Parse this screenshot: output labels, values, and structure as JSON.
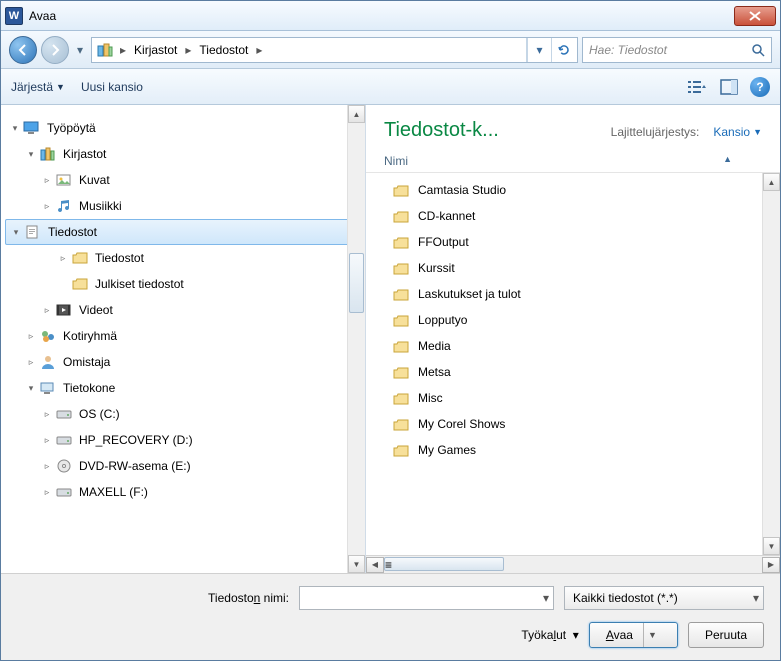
{
  "title": "Avaa",
  "breadcrumb": {
    "root_icon": "libraries",
    "items": [
      "Kirjastot",
      "Tiedostot"
    ]
  },
  "search": {
    "placeholder": "Hae: Tiedostot"
  },
  "toolbar": {
    "organize": "Järjestä",
    "new_folder": "Uusi kansio"
  },
  "list_header": {
    "title": "Tiedostot-k...",
    "sort_label": "Lajittelujärjestys:",
    "sort_value": "Kansio"
  },
  "columns": {
    "name": "Nimi"
  },
  "tree": [
    {
      "label": "Työpöytä",
      "level": 0,
      "icon": "desktop",
      "tw": "▾"
    },
    {
      "label": "Kirjastot",
      "level": 1,
      "icon": "libraries",
      "tw": "▾"
    },
    {
      "label": "Kuvat",
      "level": 2,
      "icon": "lib-pic",
      "tw": "▹"
    },
    {
      "label": "Musiikki",
      "level": 2,
      "icon": "lib-music",
      "tw": "▹"
    },
    {
      "label": "Tiedostot",
      "level": 2,
      "icon": "lib-doc",
      "tw": "▾",
      "selected": true
    },
    {
      "label": "Tiedostot",
      "level": 3,
      "icon": "folder-doc",
      "tw": "▹"
    },
    {
      "label": "Julkiset tiedostot",
      "level": 3,
      "icon": "folder",
      "tw": ""
    },
    {
      "label": "Videot",
      "level": 2,
      "icon": "lib-video",
      "tw": "▹"
    },
    {
      "label": "Kotiryhmä",
      "level": 1,
      "icon": "homegroup",
      "tw": "▹"
    },
    {
      "label": "Omistaja",
      "level": 1,
      "icon": "user",
      "tw": "▹"
    },
    {
      "label": "Tietokone",
      "level": 1,
      "icon": "computer",
      "tw": "▾"
    },
    {
      "label": "OS (C:)",
      "level": 2,
      "icon": "drive",
      "tw": "▹"
    },
    {
      "label": "HP_RECOVERY (D:)",
      "level": 2,
      "icon": "drive",
      "tw": "▹"
    },
    {
      "label": "DVD-RW-asema (E:)",
      "level": 2,
      "icon": "optical",
      "tw": "▹"
    },
    {
      "label": "MAXELL (F:)",
      "level": 2,
      "icon": "drive",
      "tw": "▹"
    }
  ],
  "files": [
    "Camtasia Studio",
    "CD-kannet",
    "FFOutput",
    "Kurssit",
    "Laskutukset ja tulot",
    "Lopputyo",
    "Media",
    "Metsa",
    "Misc",
    "My Corel Shows",
    "My Games"
  ],
  "footer": {
    "filename_label": "Tiedoston nimi:",
    "filter": "Kaikki tiedostot (*.*)",
    "tools": "Työkalut",
    "open": "Avaa",
    "cancel": "Peruuta"
  }
}
